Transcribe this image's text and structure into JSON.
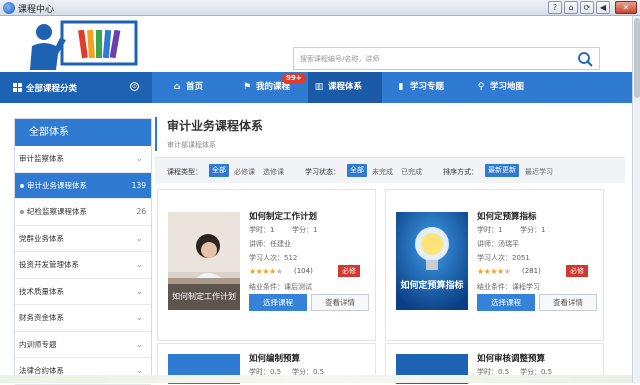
{
  "window": {
    "title": "课程中心",
    "buttons": [
      "?",
      "⌂",
      "⟳",
      "◀",
      "✕"
    ]
  },
  "search": {
    "placeholder": "搜索课程编号/名称，讲师"
  },
  "nav": {
    "all_categories": "全部课程分类",
    "items": [
      {
        "label": "首页",
        "icon": "home-icon"
      },
      {
        "label": "我的课程",
        "icon": "flag-icon",
        "badge": "99+"
      },
      {
        "label": "课程体系",
        "icon": "book-icon",
        "active": true
      },
      {
        "label": "学习专题",
        "icon": "bookmark-icon"
      },
      {
        "label": "学习地图",
        "icon": "map-pin-icon"
      }
    ]
  },
  "sidebar": {
    "title": "全部体系",
    "items": [
      {
        "label": "审计监察体系",
        "chevron": "v"
      },
      {
        "label": "审计业务课程体系",
        "count": "139",
        "sub": true,
        "selected": true
      },
      {
        "label": "纪检监察课程体系",
        "count": "26",
        "sub": true
      },
      {
        "label": "党群业务体系",
        "chevron": "v"
      },
      {
        "label": "投资开发管理体系",
        "chevron": "v"
      },
      {
        "label": "技术质量体系",
        "chevron": "v"
      },
      {
        "label": "财务资金体系",
        "chevron": "v"
      },
      {
        "label": "内训师专题",
        "chevron": "v"
      },
      {
        "label": "法律合约体系",
        "chevron": "v"
      }
    ]
  },
  "main": {
    "title": "审计业务课程体系",
    "breadcrumb": "审计部课程体系",
    "filters": {
      "type_label": "课程类型：",
      "type_options": [
        "全部",
        "必修课",
        "选修课"
      ],
      "status_label": "学习状态：",
      "status_options": [
        "全部",
        "未完成",
        "已完成"
      ],
      "sort_label": "排序方式：",
      "sort_options": [
        "最新更新",
        "最近学习"
      ]
    },
    "courses": [
      {
        "title": "如何制定工作计划",
        "hours": "学时：1",
        "credits": "学分：1",
        "lecturer": "讲师：任建业",
        "learners": "学习人次：512",
        "rating": 4,
        "reviews": "(104)",
        "required": "必修",
        "condition": "结业条件：课后测试",
        "image_caption": "如何制定工作计划",
        "select_btn": "选择课程",
        "detail_btn": "查看详情"
      },
      {
        "title": "如何定预算指标",
        "hours": "学时：1",
        "credits": "学分：1",
        "lecturer": "讲师：汤瑞平",
        "learners": "学习人次：2051",
        "rating": 4,
        "reviews": "(281)",
        "required": "必修",
        "condition": "结业条件：课程学习",
        "image_caption": "如何定预算指标",
        "select_btn": "选择课程",
        "detail_btn": "查看详情"
      },
      {
        "title": "如何编制预算",
        "hours": "学时：0.5",
        "credits": "学分：0.5"
      },
      {
        "title": "如何审核调整预算",
        "hours": "学时：0.5",
        "credits": "学分：0.5"
      }
    ]
  },
  "colors": {
    "primary": "#2f7bd1",
    "primary_dark": "#1e63b3",
    "required": "#d2382b",
    "star": "#f2a21b"
  }
}
